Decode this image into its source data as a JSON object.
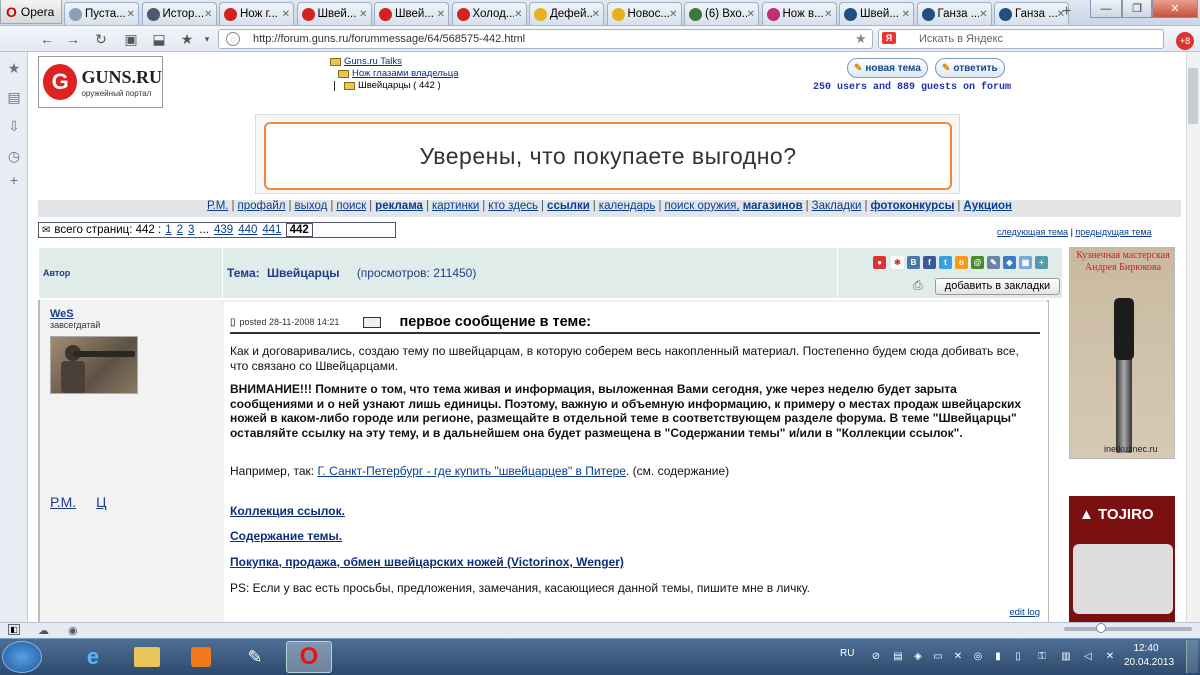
{
  "browser": {
    "menu_label": "Opera",
    "tabs": [
      {
        "label": "Пуста...",
        "icon": "page-icon",
        "color": "#8aa0b8"
      },
      {
        "label": "Истор...",
        "icon": "clock-icon",
        "color": "#4a5a70"
      },
      {
        "label": "Нож г...",
        "icon": "guns-icon",
        "color": "#d22222"
      },
      {
        "label": "Швей...",
        "icon": "guns-icon",
        "color": "#d22222"
      },
      {
        "label": "Швей...",
        "icon": "guns-icon",
        "color": "#d22222"
      },
      {
        "label": "Холод...",
        "icon": "guns-icon",
        "color": "#d22222"
      },
      {
        "label": "Дефей...",
        "icon": "smiley-icon",
        "color": "#e8b020"
      },
      {
        "label": "Новос...",
        "icon": "smiley-icon",
        "color": "#e8b020"
      },
      {
        "label": "(6) Вхо...",
        "icon": "mail-icon",
        "color": "#3a7a3a"
      },
      {
        "label": "Нож в...",
        "icon": "site-icon",
        "color": "#c03070"
      },
      {
        "label": "Швей...",
        "icon": "rk-icon",
        "color": "#205080"
      },
      {
        "label": "Ганза ...",
        "icon": "rk-icon",
        "color": "#205080"
      },
      {
        "label": "Ганза ...",
        "icon": "rk-icon",
        "color": "#205080"
      }
    ],
    "url": "http://forum.guns.ru/forummessage/64/568575-442.html",
    "search_placeholder": "Искать в Яндекс",
    "search_engine": "Я"
  },
  "site": {
    "logo_title": "GUNS.RU",
    "logo_subtitle": "оружейный портал",
    "breadcrumb": [
      "Guns.ru Talks",
      "Нож глазами владельца",
      "Швейцарцы ( 442 )"
    ],
    "new_topic_label": "новая тема",
    "reply_label": "ответить",
    "online": "250 users and 889 guests on forum",
    "banner_text": "Уверены,  что покупаете   выгодно?"
  },
  "menu": {
    "items": [
      "Р.М.",
      "профайл",
      "выход",
      "поиск",
      "реклама",
      "картинки",
      "кто здесь",
      "ссылки",
      "календарь",
      "поиск оружия,",
      "магазинов",
      "Закладки",
      "фотоконкурсы",
      "Аукцион"
    ]
  },
  "pagination": {
    "label": "всего страниц: 442 :",
    "pages": [
      "1",
      "2",
      "3",
      "...",
      "439",
      "440",
      "441"
    ],
    "current": "442",
    "next_topic": "следующая тема",
    "prev_topic": "предыдущая тема"
  },
  "topic": {
    "author_header": "Автор",
    "topic_label": "Тема:",
    "topic_title": "Швейцарцы",
    "views": "(просмотров: 211450)",
    "add_bookmark": "добавить в закладки"
  },
  "post": {
    "nick": "WeS",
    "rank": "завсегдатай",
    "pm": "Р.М.",
    "quote": "Ц",
    "date": "posted 28-11-2008 14:21",
    "title": "первое сообщение в теме:",
    "p1": "Как и договаривались, создаю тему по швейцарцам, в которую соберем весь накопленный материал. Постепенно будем сюда добивать все, что связано со Швейцарцами.",
    "p2": "ВНИМАНИЕ!!! Помните о том, что тема живая и информация, выложенная Вами сегодня, уже через неделю будет зарыта сообщениями и о ней узнают лишь единицы. Поэтому, важную и объемную информацию, к примеру о местах продаж швейцарских ножей в каком-либо городе или регионе, размещайте в отдельной теме в соответствующем разделе форума. В теме \"Швейцарцы\" оставляйте ссылку на эту тему, и в дальнейшем она будет размещена в \"Содержании темы\" и/или в \"Коллекции ссылок\".",
    "p3_prefix": "Например, так:",
    "p3_link": "Г. Санкт-Петербург - где купить \"швейцарцев\" в Питере",
    "p3_suffix": ". (см. содержание)",
    "link1": "Коллекция ссылок.",
    "link2": "Содержание темы.",
    "link3": "Покупка, продажа, обмен швейцарских ножей (Victorinox, Wenger)",
    "ps": "PS: Если у вас есть просьбы, предложения, замечания, касающиеся данной темы, пишите мне в личку.",
    "edit_log": "edit log"
  },
  "ads": {
    "ad1_title": "Кузнечная мастерская Андрея Бирюкова",
    "ad1_site": "inetkuznec.ru",
    "ad2_brand": "TOJIRO"
  },
  "taskbar": {
    "lang": "RU",
    "time": "12:40",
    "date": "20.04.2013"
  }
}
